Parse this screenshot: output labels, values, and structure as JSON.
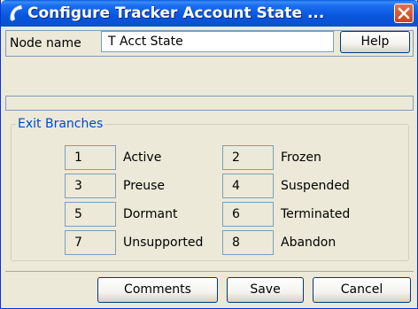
{
  "window": {
    "title": "Configure Tracker Account State ..."
  },
  "node": {
    "label": "Node name",
    "value": "T Acct State",
    "help_label": "Help"
  },
  "exit_branches": {
    "legend": "Exit Branches",
    "items": [
      {
        "num": "1",
        "label": "Active"
      },
      {
        "num": "2",
        "label": "Frozen"
      },
      {
        "num": "3",
        "label": "Preuse"
      },
      {
        "num": "4",
        "label": "Suspended"
      },
      {
        "num": "5",
        "label": "Dormant"
      },
      {
        "num": "6",
        "label": "Terminated"
      },
      {
        "num": "7",
        "label": "Unsupported"
      },
      {
        "num": "8",
        "label": "Abandon"
      }
    ]
  },
  "footer": {
    "comments_label": "Comments",
    "save_label": "Save",
    "cancel_label": "Cancel"
  },
  "colors": {
    "titlebar": "#0856dd",
    "close": "#c8421e",
    "legend_text": "#0046d5",
    "window_bg": "#ece9d8"
  },
  "icons": {
    "title": "phone-handset-icon",
    "close": "close-icon"
  }
}
